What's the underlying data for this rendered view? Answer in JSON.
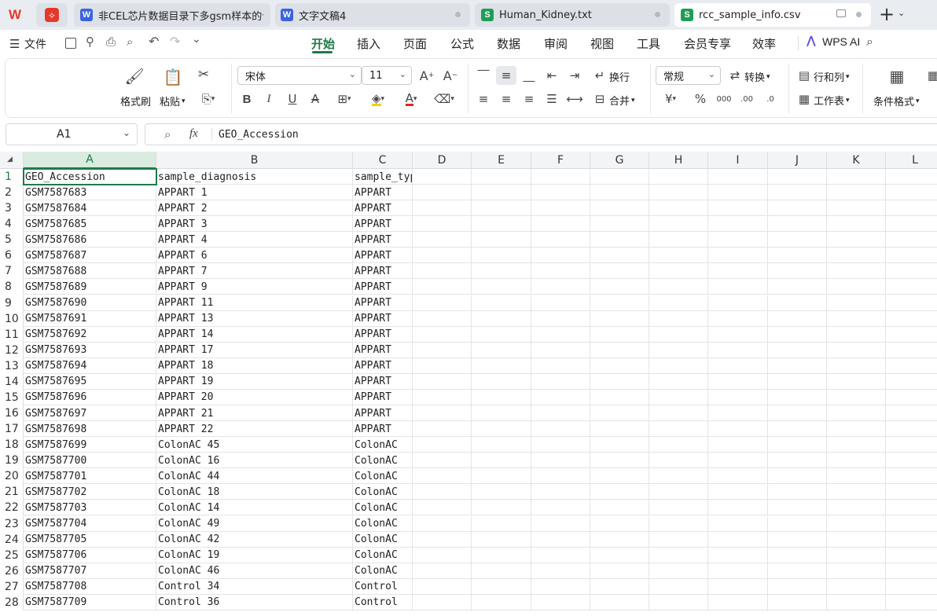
{
  "tabs": [
    {
      "icon": "W",
      "label": "非CEL芯片数据目录下多gsm样本的合",
      "state": "inactive",
      "color": "#3a63e0"
    },
    {
      "icon": "W",
      "label": "文字文稿4",
      "state": "inactive",
      "color": "#3a63e0"
    },
    {
      "icon": "S",
      "label": "Human_Kidney.txt",
      "state": "inactive",
      "color": "#1f9d55"
    },
    {
      "icon": "S",
      "label": "rcc_sample_info.csv",
      "state": "active",
      "color": "#1f9d55"
    }
  ],
  "menu": {
    "file_label": "文件",
    "items": [
      "开始",
      "插入",
      "页面",
      "公式",
      "数据",
      "审阅",
      "视图",
      "工具",
      "会员专享",
      "效率"
    ],
    "active_index": 0,
    "wps_ai": "WPS AI"
  },
  "ribbon": {
    "format_painter": "格式刷",
    "paste": "粘贴",
    "font_name": "宋体",
    "font_size": "11",
    "wrap": "换行",
    "merge": "合并",
    "number_format": "常规",
    "convert": "转换",
    "row_col": "行和列",
    "worksheet": "工作表",
    "cond_format": "条件格式"
  },
  "formula_bar": {
    "name_box": "A1",
    "fx": "fx",
    "content": "GEO_Accession"
  },
  "columns": [
    "A",
    "B",
    "C",
    "D",
    "E",
    "F",
    "G",
    "H",
    "I",
    "J",
    "K",
    "L"
  ],
  "rows": [
    [
      "GEO_Accession",
      "sample_diagnosis",
      "sample_type"
    ],
    [
      "GSM7587683",
      "APPART 1",
      "APPART"
    ],
    [
      "GSM7587684",
      "APPART 2",
      "APPART"
    ],
    [
      "GSM7587685",
      "APPART 3",
      "APPART"
    ],
    [
      "GSM7587686",
      "APPART 4",
      "APPART"
    ],
    [
      "GSM7587687",
      "APPART 6",
      "APPART"
    ],
    [
      "GSM7587688",
      "APPART 7",
      "APPART"
    ],
    [
      "GSM7587689",
      "APPART 9",
      "APPART"
    ],
    [
      "GSM7587690",
      "APPART 11",
      "APPART"
    ],
    [
      "GSM7587691",
      "APPART 13",
      "APPART"
    ],
    [
      "GSM7587692",
      "APPART 14",
      "APPART"
    ],
    [
      "GSM7587693",
      "APPART 17",
      "APPART"
    ],
    [
      "GSM7587694",
      "APPART 18",
      "APPART"
    ],
    [
      "GSM7587695",
      "APPART 19",
      "APPART"
    ],
    [
      "GSM7587696",
      "APPART 20",
      "APPART"
    ],
    [
      "GSM7587697",
      "APPART 21",
      "APPART"
    ],
    [
      "GSM7587698",
      "APPART 22",
      "APPART"
    ],
    [
      "GSM7587699",
      "ColonAC 45",
      "ColonAC"
    ],
    [
      "GSM7587700",
      "ColonAC 16",
      "ColonAC"
    ],
    [
      "GSM7587701",
      "ColonAC 44",
      "ColonAC"
    ],
    [
      "GSM7587702",
      "ColonAC 18",
      "ColonAC"
    ],
    [
      "GSM7587703",
      "ColonAC 14",
      "ColonAC"
    ],
    [
      "GSM7587704",
      "ColonAC 49",
      "ColonAC"
    ],
    [
      "GSM7587705",
      "ColonAC 42",
      "ColonAC"
    ],
    [
      "GSM7587706",
      "ColonAC 19",
      "ColonAC"
    ],
    [
      "GSM7587707",
      "ColonAC 46",
      "ColonAC"
    ],
    [
      "GSM7587708",
      "Control 34",
      "Control"
    ],
    [
      "GSM7587709",
      "Control 36",
      "Control"
    ]
  ],
  "colors": {
    "accent": "#1f7a4a"
  }
}
